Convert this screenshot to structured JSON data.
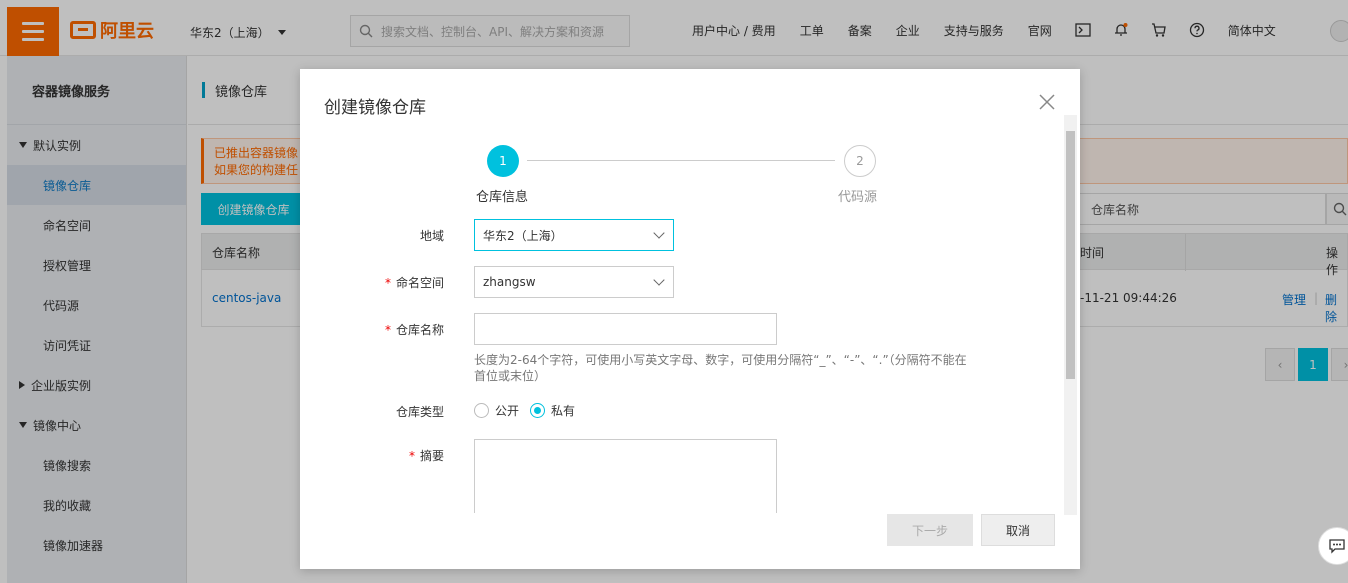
{
  "topbar": {
    "logo_text": "阿里云",
    "region": "华东2（上海）",
    "search_placeholder": "搜索文档、控制台、API、解决方案和资源",
    "nav": [
      "用户中心 / 费用",
      "工单",
      "备案",
      "企业",
      "支持与服务",
      "官网"
    ],
    "language": "简体中文",
    "icons": [
      "terminal-icon",
      "bell-icon",
      "cart-icon",
      "help-icon"
    ]
  },
  "sidebar": {
    "title": "容器镜像服务",
    "group_default": "默认实例",
    "items_default": [
      "镜像仓库",
      "命名空间",
      "授权管理",
      "代码源",
      "访问凭证"
    ],
    "group_enterprise": "企业版实例",
    "group_center": "镜像中心",
    "items_center": [
      "镜像搜索",
      "我的收藏",
      "镜像加速器"
    ]
  },
  "main": {
    "title": "镜像仓库",
    "notice_line1": "已推出容器镜像",
    "notice_line2": "如果您的构建任",
    "create_button": "创建镜像仓库",
    "search_placeholder": "仓库名称",
    "table": {
      "col_name": "仓库名称",
      "col_time": "时间",
      "col_ops": "操作",
      "row_name": "centos-java",
      "row_time": "-11-21 09:44:26",
      "op_manage": "管理",
      "op_sep": "|",
      "op_delete": "删除"
    },
    "pager_current": "1"
  },
  "modal": {
    "title": "创建镜像仓库",
    "steps": [
      {
        "num": "1",
        "label": "仓库信息"
      },
      {
        "num": "2",
        "label": "代码源"
      }
    ],
    "region_label": "地域",
    "region_value": "华东2（上海）",
    "namespace_label": "命名空间",
    "namespace_value": "zhangsw",
    "repo_name_label": "仓库名称",
    "repo_name_hint": "长度为2-64个字符，可使用小写英文字母、数字，可使用分隔符“_”、“-”、“.”（分隔符不能在首位或末位）",
    "repo_type_label": "仓库类型",
    "repo_type_options": [
      "公开",
      "私有"
    ],
    "repo_type_selected": "私有",
    "summary_label": "摘要",
    "required_mark": "*",
    "next_button": "下一步",
    "cancel_button": "取消"
  },
  "colors": {
    "brand": "#ff6a00",
    "accent": "#00c1de"
  }
}
